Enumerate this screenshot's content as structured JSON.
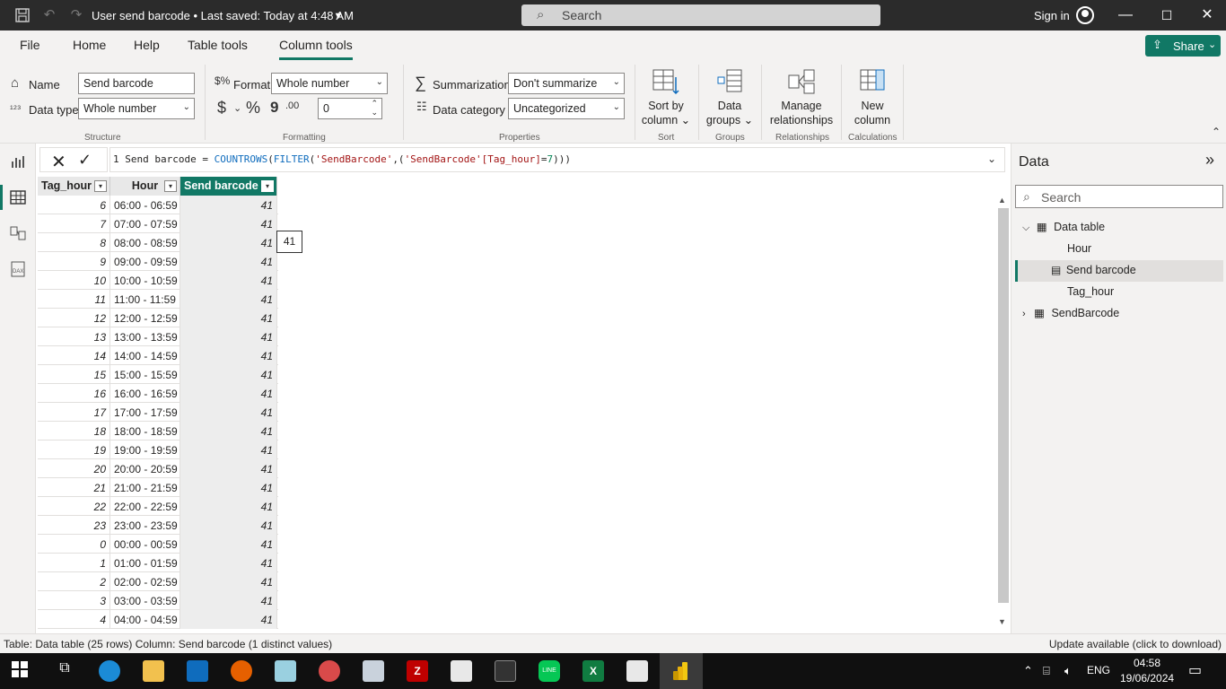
{
  "titlebar": {
    "title": "User send barcode • Last saved: Today at 4:48 AM",
    "search_placeholder": "Search",
    "sign_in": "Sign in"
  },
  "menu": {
    "tabs": [
      "File",
      "Home",
      "Help",
      "Table tools",
      "Column tools"
    ],
    "active_tab": "Column tools",
    "share_label": "Share"
  },
  "ribbon": {
    "name_label": "Name",
    "name_value": "Send barcode",
    "datatype_label": "Data type",
    "datatype_value": "Whole number",
    "structure_label": "Structure",
    "format_label": "Format",
    "format_value": "Whole number",
    "currency_symbol": "$",
    "percent_symbol": "%",
    "comma_symbol": "9",
    "decimal_symbol": ".00",
    "decimals_value": "0",
    "formatting_label": "Formatting",
    "summarization_label": "Summarization",
    "summarization_value": "Don't summarize",
    "datacategory_label": "Data category",
    "datacategory_value": "Uncategorized",
    "properties_label": "Properties",
    "sort_by_line1": "Sort by",
    "sort_by_line2": "column",
    "sort_label": "Sort",
    "data_groups_line1": "Data",
    "data_groups_line2": "groups",
    "groups_label": "Groups",
    "manage_rel_line1": "Manage",
    "manage_rel_line2": "relationships",
    "relationships_label": "Relationships",
    "new_col_line1": "New",
    "new_col_line2": "column",
    "calculations_label": "Calculations"
  },
  "formula": {
    "line_no": "1",
    "measure": "Send barcode",
    "func1": "COUNTROWS",
    "func2": "FILTER",
    "table_ref": "'SendBarcode'",
    "col_ref": "'SendBarcode'[Tag_hour]",
    "num": "7"
  },
  "table": {
    "columns": [
      "Tag_hour",
      "Hour",
      "Send barcode"
    ],
    "selected_column": "Send barcode",
    "rows": [
      [
        "6",
        "06:00 - 06:59",
        "41"
      ],
      [
        "7",
        "07:00 - 07:59",
        "41"
      ],
      [
        "8",
        "08:00 - 08:59",
        "41"
      ],
      [
        "9",
        "09:00 - 09:59",
        "41"
      ],
      [
        "10",
        "10:00 - 10:59",
        "41"
      ],
      [
        "11",
        "11:00 - 11:59",
        "41"
      ],
      [
        "12",
        "12:00 - 12:59",
        "41"
      ],
      [
        "13",
        "13:00 - 13:59",
        "41"
      ],
      [
        "14",
        "14:00 - 14:59",
        "41"
      ],
      [
        "15",
        "15:00 - 15:59",
        "41"
      ],
      [
        "16",
        "16:00 - 16:59",
        "41"
      ],
      [
        "17",
        "17:00 - 17:59",
        "41"
      ],
      [
        "18",
        "18:00 - 18:59",
        "41"
      ],
      [
        "19",
        "19:00 - 19:59",
        "41"
      ],
      [
        "20",
        "20:00 - 20:59",
        "41"
      ],
      [
        "21",
        "21:00 - 21:59",
        "41"
      ],
      [
        "22",
        "22:00 - 22:59",
        "41"
      ],
      [
        "23",
        "23:00 - 23:59",
        "41"
      ],
      [
        "0",
        "00:00 - 00:59",
        "41"
      ],
      [
        "1",
        "01:00 - 01:59",
        "41"
      ],
      [
        "2",
        "02:00 - 02:59",
        "41"
      ],
      [
        "3",
        "03:00 - 03:59",
        "41"
      ],
      [
        "4",
        "04:00 - 04:59",
        "41"
      ]
    ],
    "tooltip_value": "41"
  },
  "data_pane": {
    "title": "Data",
    "search_placeholder": "Search",
    "tables": [
      {
        "name": "Data table",
        "expanded": true,
        "fields": [
          "Hour",
          "Send barcode",
          "Tag_hour"
        ],
        "selected_field": "Send barcode"
      },
      {
        "name": "SendBarcode",
        "expanded": false,
        "fields": []
      }
    ]
  },
  "status": {
    "left": "Table: Data table (25 rows) Column: Send barcode (1 distinct values)",
    "right": "Update available (click to download)"
  },
  "taskbar": {
    "language": "ENG",
    "time": "04:58",
    "date": "19/06/2024"
  },
  "colors": {
    "accent": "#117865",
    "titlebar": "#2b2b2b",
    "ribbon": "#f3f2f1"
  }
}
